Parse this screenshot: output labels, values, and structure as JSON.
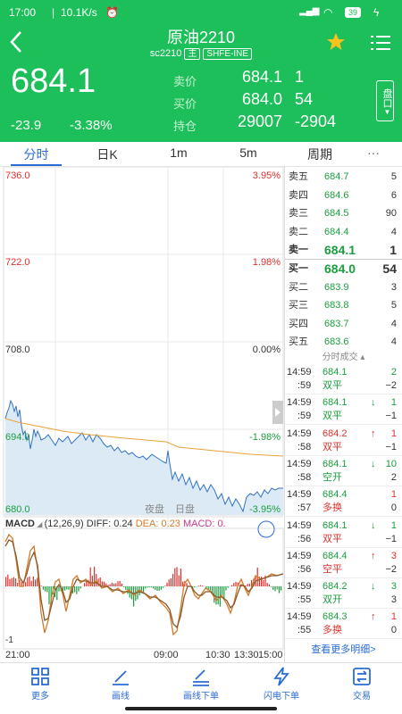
{
  "status": {
    "time": "17:00",
    "speed": "10.1K/s",
    "battery": "39"
  },
  "header": {
    "title": "原油2210",
    "code": "sc2210",
    "main_tag": "主",
    "exchange": "SHFE-INE",
    "price": "684.1",
    "change": "-23.9",
    "change_pct": "-3.38%",
    "sell_label": "卖价",
    "sell_price": "684.1",
    "sell_qty": "1",
    "buy_label": "买价",
    "buy_price": "684.0",
    "buy_qty": "54",
    "oi_label": "持仓",
    "oi": "29007",
    "oi_change": "-2904",
    "panel_btn": "盘口"
  },
  "tabs": [
    "分时",
    "日K",
    "1m",
    "5m",
    "周期",
    "···"
  ],
  "chart": {
    "y_left": [
      "736.0",
      "722.0",
      "708.0",
      "694.0",
      "680.0"
    ],
    "y_right": [
      "3.95%",
      "1.98%",
      "0.00%",
      "-1.98%",
      "-3.95%"
    ],
    "session1": "夜盘",
    "session2": "日盘",
    "macd_title": "MACD",
    "macd_params": "(12,26,9)",
    "diff": "DIFF: 0.24",
    "dea": "DEA: 0.23",
    "macd_val": "MACD: 0.",
    "macd_neg": "-1",
    "time_labels": [
      "21:00",
      "09:00",
      "10:30",
      "13:30",
      "15:00"
    ]
  },
  "chart_data": {
    "type": "line",
    "title": "",
    "x": [
      "21:00",
      "09:00",
      "10:30",
      "13:30",
      "15:00"
    ],
    "ylim": [
      680.0,
      736.0
    ],
    "series": [
      {
        "values": [
          697,
          696,
          694,
          692,
          693,
          691,
          690,
          686,
          684
        ]
      },
      {
        "values": [
          693,
          693,
          693,
          692,
          692,
          691,
          691,
          690,
          689
        ]
      }
    ]
  },
  "book": {
    "asks": [
      {
        "label": "卖五",
        "price": "684.7",
        "qty": "5"
      },
      {
        "label": "卖四",
        "price": "684.6",
        "qty": "6"
      },
      {
        "label": "卖三",
        "price": "684.5",
        "qty": "90"
      },
      {
        "label": "卖二",
        "price": "684.4",
        "qty": "4"
      },
      {
        "label": "卖一",
        "price": "684.1",
        "qty": "1"
      }
    ],
    "bids": [
      {
        "label": "买一",
        "price": "684.0",
        "qty": "54"
      },
      {
        "label": "买二",
        "price": "683.9",
        "qty": "3"
      },
      {
        "label": "买三",
        "price": "683.8",
        "qty": "5"
      },
      {
        "label": "买四",
        "price": "683.7",
        "qty": "4"
      },
      {
        "label": "买五",
        "price": "683.6",
        "qty": "4"
      }
    ],
    "trades_title": "分时成交",
    "trades": [
      {
        "t1": "14:59",
        "t2": ":59",
        "price": "684.1",
        "arrow": "",
        "vol": "2",
        "type": "双平",
        "oi": "−2",
        "pc": "g",
        "tc": "g",
        "vc": "g"
      },
      {
        "t1": "14:59",
        "t2": ":59",
        "price": "684.1",
        "arrow": "↓",
        "vol": "1",
        "type": "双平",
        "oi": "−1",
        "pc": "g",
        "tc": "g",
        "vc": "g"
      },
      {
        "t1": "14:59",
        "t2": ":58",
        "price": "684.2",
        "arrow": "↑",
        "vol": "1",
        "type": "双平",
        "oi": "−1",
        "pc": "r",
        "tc": "r",
        "vc": "r"
      },
      {
        "t1": "14:59",
        "t2": ":58",
        "price": "684.1",
        "arrow": "↓",
        "vol": "10",
        "type": "空开",
        "oi": "2",
        "pc": "g",
        "tc": "g",
        "vc": "g"
      },
      {
        "t1": "14:59",
        "t2": ":57",
        "price": "684.4",
        "arrow": "",
        "vol": "1",
        "type": "多换",
        "oi": "0",
        "pc": "g",
        "tc": "r",
        "vc": "r"
      },
      {
        "t1": "14:59",
        "t2": ":56",
        "price": "684.1",
        "arrow": "↓",
        "vol": "1",
        "type": "双平",
        "oi": "−1",
        "pc": "g",
        "tc": "r",
        "vc": "g"
      },
      {
        "t1": "14:59",
        "t2": ":56",
        "price": "684.4",
        "arrow": "↑",
        "vol": "3",
        "type": "空平",
        "oi": "−2",
        "pc": "g",
        "tc": "r",
        "vc": "r"
      },
      {
        "t1": "14:59",
        "t2": ":55",
        "price": "684.2",
        "arrow": "↓",
        "vol": "3",
        "type": "双开",
        "oi": "3",
        "pc": "g",
        "tc": "g",
        "vc": "g"
      },
      {
        "t1": "14:59",
        "t2": ":55",
        "price": "684.3",
        "arrow": "↑",
        "vol": "1",
        "type": "多换",
        "oi": "0",
        "pc": "g",
        "tc": "r",
        "vc": "r"
      }
    ],
    "more": "查看更多明细>"
  },
  "bottom": [
    "更多",
    "画线",
    "画线下单",
    "闪电下单",
    "交易"
  ]
}
